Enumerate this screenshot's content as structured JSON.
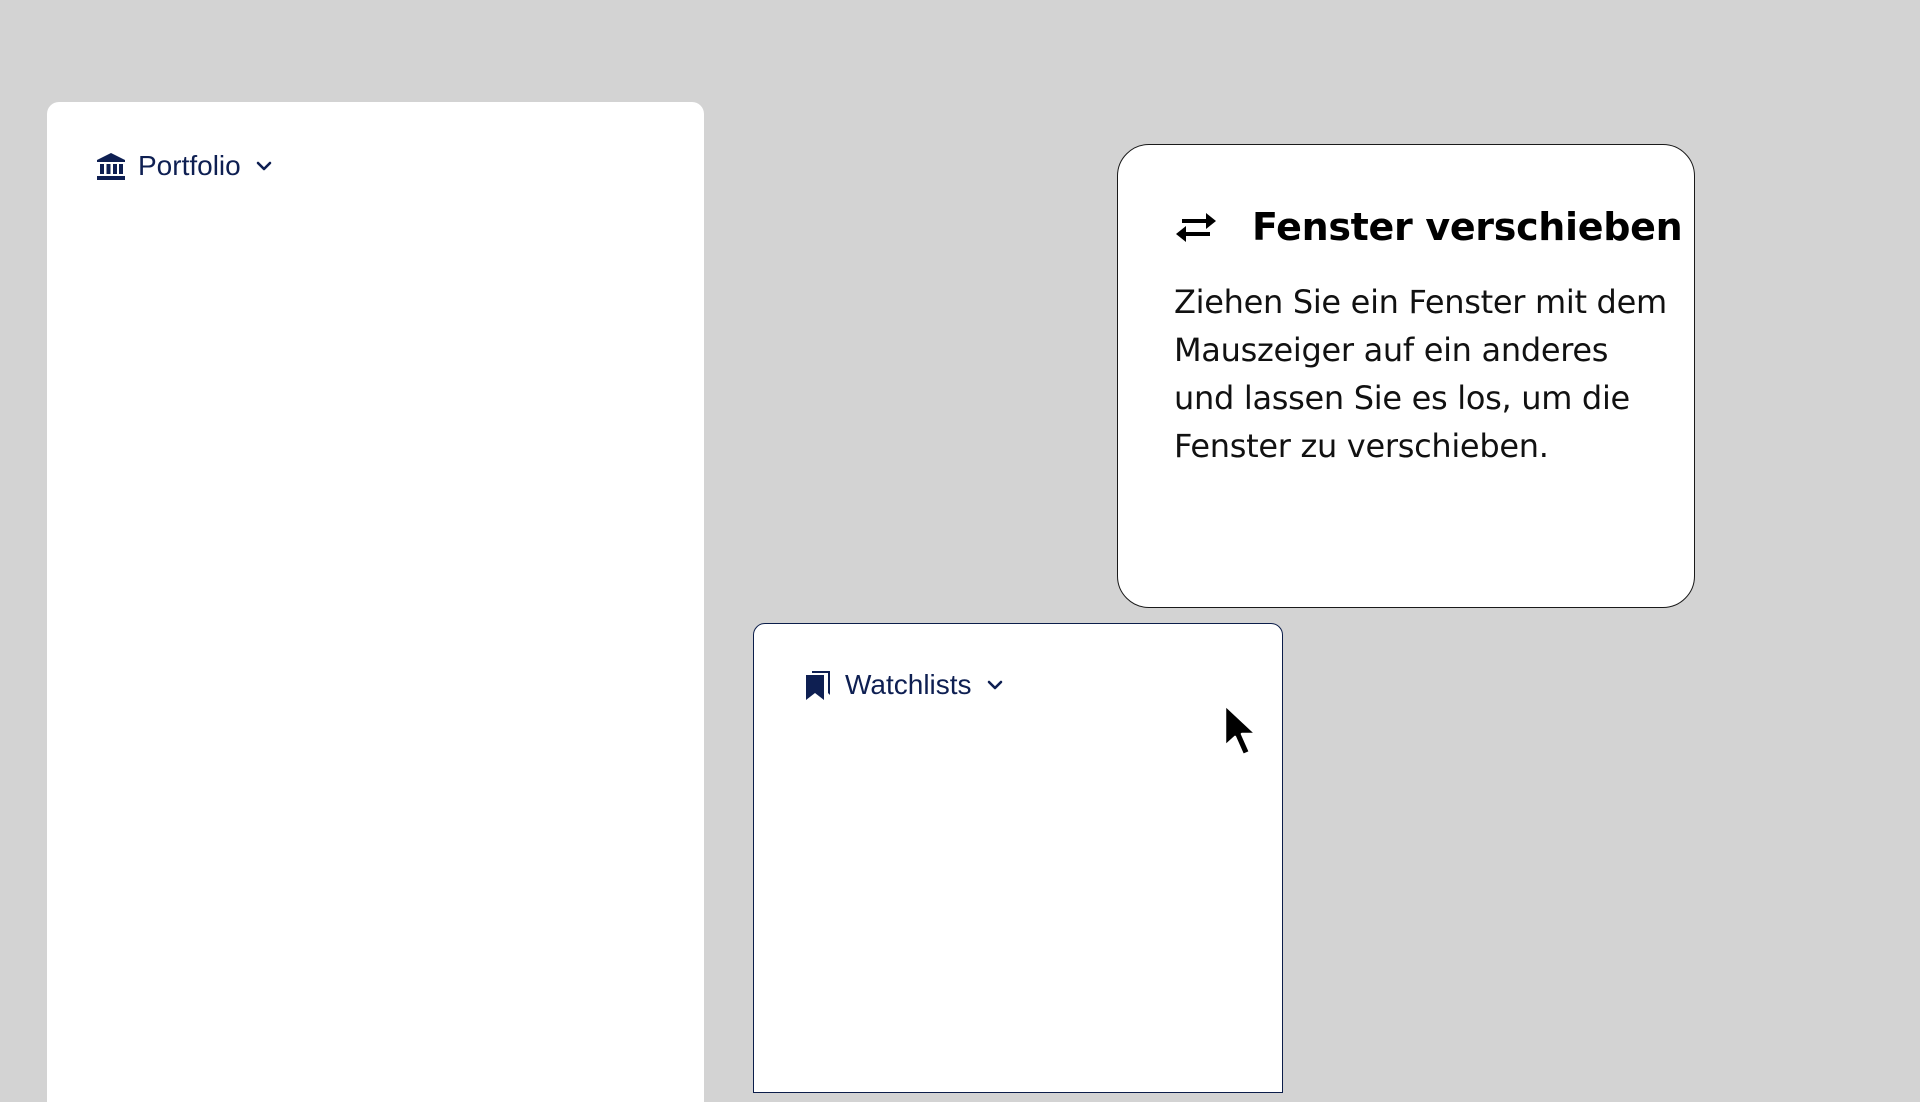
{
  "portfolio": {
    "label": "Portfolio",
    "icon": "bank-icon"
  },
  "watchlists": {
    "label": "Watchlists",
    "icon": "bookmarks-icon"
  },
  "tooltip": {
    "icon": "swap-arrows-icon",
    "title": "Fenster verschieben",
    "body": "Ziehen Sie ein Fenster mit dem Mauszeiger auf ein anderes und lassen Sie es los, um die Fenster zu verschieben."
  },
  "colors": {
    "background": "#d3d3d3",
    "panel": "#ffffff",
    "accent_navy": "#0e1f52",
    "text": "#000000"
  }
}
